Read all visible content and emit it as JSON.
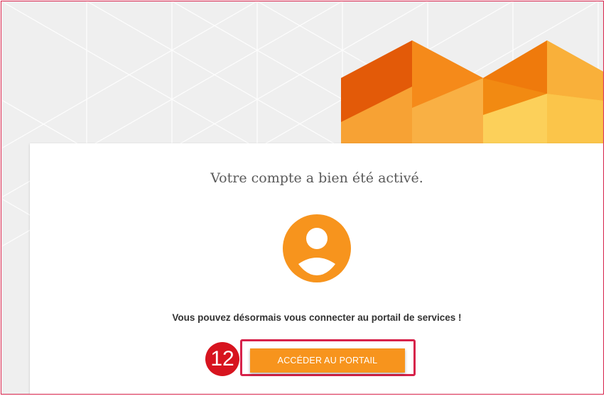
{
  "card": {
    "title": "Votre compte a bien été activé.",
    "message": "Vous pouvez désormais vous connecter au portail de services !",
    "button_label": "ACCÉDER AU PORTAIL",
    "avatar_icon": "user-circle-icon"
  },
  "annotation": {
    "step_number": "12"
  },
  "colors": {
    "accent": "#f7941d",
    "highlight": "#d7224a",
    "badge": "#d7141f",
    "background": "#efefef"
  }
}
